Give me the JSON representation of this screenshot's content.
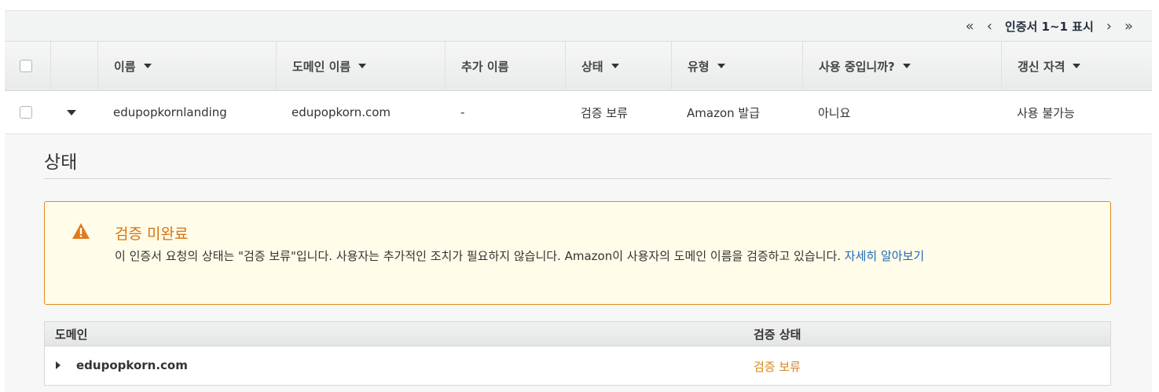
{
  "pager": {
    "first": "«",
    "prev": "‹",
    "label": "인증서 1~1 표시",
    "next": "›",
    "last": "»"
  },
  "table": {
    "headers": [
      "",
      "",
      "이름",
      "도메인 이름",
      "추가 이름",
      "상태",
      "유형",
      "사용 중입니까?",
      "갱신 자격"
    ],
    "sortable": [
      false,
      false,
      true,
      true,
      false,
      true,
      true,
      true,
      true
    ],
    "row": {
      "name": "edupopkornlanding",
      "domain": "edupopkorn.com",
      "additional": "-",
      "status": "검증 보류",
      "type": "Amazon 발급",
      "in_use": "아니요",
      "renewal": "사용 불가능"
    }
  },
  "detail": {
    "heading": "상태",
    "alert": {
      "icon": "warning-icon",
      "title": "검증 미완료",
      "message": "이 인증서 요청의 상태는 \"검증 보류\"입니다. 사용자는 추가적인 조치가 필요하지 않습니다. Amazon이 사용자의 도메인 이름을 검증하고 있습니다. ",
      "link": "자세히 알아보기"
    },
    "domain_table": {
      "col_domain": "도메인",
      "col_status": "검증 상태",
      "rows": [
        {
          "domain": "edupopkorn.com",
          "status": "검증 보류"
        }
      ]
    }
  },
  "colors": {
    "warning": "#d6861b",
    "link": "#1f68b7",
    "alert_border": "#dd8d21",
    "alert_bg": "#fffce9"
  }
}
